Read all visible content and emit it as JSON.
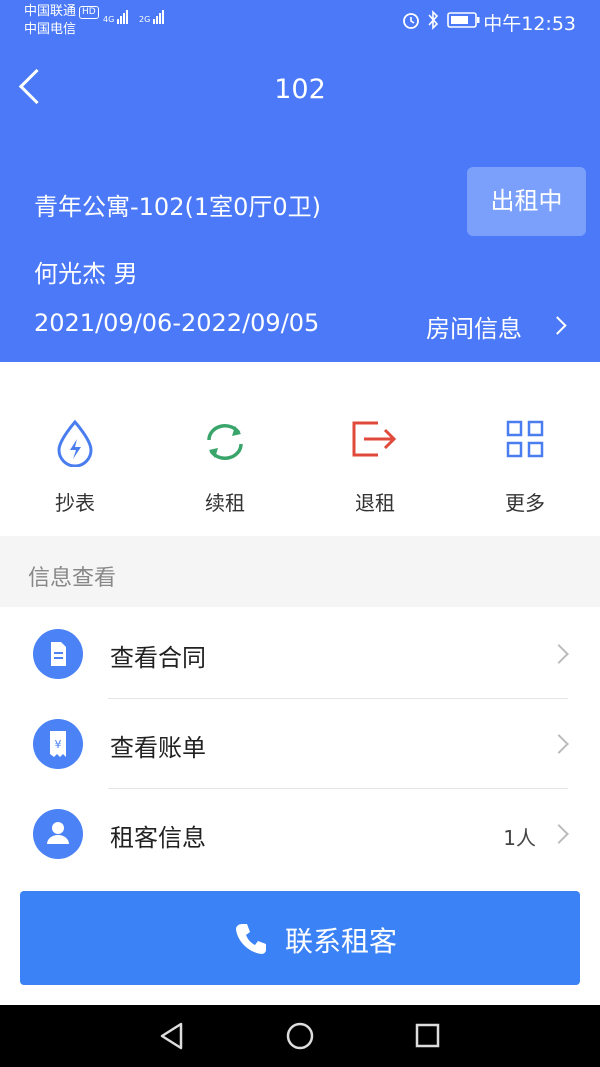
{
  "status_bar": {
    "carrier_1": "中国联通",
    "carrier_1_badge": "HD",
    "carrier_2": "中国电信",
    "signal_1": "4G",
    "signal_2": "2G",
    "time": "中午12:53",
    "icons": [
      "alarm-icon",
      "bluetooth-icon",
      "battery-icon"
    ]
  },
  "header": {
    "title": "102",
    "room_name": "青年公寓-102(1室0厅0卫)",
    "status": "出租中",
    "tenant": "何光杰  男",
    "lease_dates": "2021/09/06-2022/09/05",
    "room_info_link": "房间信息"
  },
  "actions": [
    {
      "label": "抄表",
      "icon": "meter-drop-icon",
      "color": "#4a7ef0"
    },
    {
      "label": "续租",
      "icon": "renew-icon",
      "color": "#3aa56b"
    },
    {
      "label": "退租",
      "icon": "checkout-icon",
      "color": "#e04a3a"
    },
    {
      "label": "更多",
      "icon": "grid-icon",
      "color": "#4a7ef0"
    }
  ],
  "info_section": {
    "title": "信息查看",
    "rows": [
      {
        "label": "查看合同",
        "value": "",
        "icon": "contract-icon"
      },
      {
        "label": "查看账单",
        "value": "",
        "icon": "bill-icon"
      },
      {
        "label": "租客信息",
        "value": "1人",
        "icon": "person-icon"
      }
    ]
  },
  "contact_button": {
    "label": "联系租客",
    "icon": "phone-icon"
  },
  "colors": {
    "primary": "#4b79f7",
    "button": "#3b82f6",
    "badge": "#7ba0fb"
  }
}
